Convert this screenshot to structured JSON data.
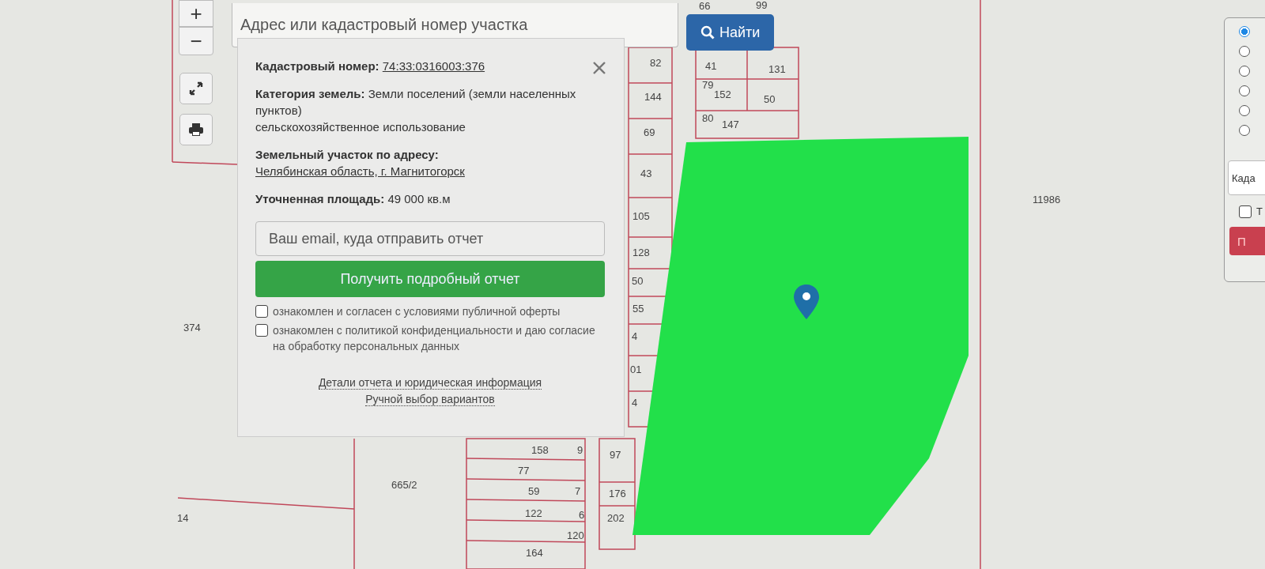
{
  "map_controls": {
    "zoom_in": "+",
    "zoom_out": "−"
  },
  "search": {
    "placeholder": "Адрес или кадастровый номер участка",
    "button": "Найти"
  },
  "popup": {
    "rows": [
      {
        "label": "Кадастровый номер:",
        "value": "74:33:0316003:376",
        "link": true
      },
      {
        "label": "Категория земель:",
        "value": "Земли поселений (земли населенных пунктов)",
        "link": false,
        "extra": "сельскохозяйственное использование"
      },
      {
        "label": "Земельный участок по адресу:",
        "value": "Челябинская область, г. Магнитогорск",
        "link": true
      },
      {
        "label": "Уточненная площадь:",
        "value": "49 000 кв.м",
        "link": false
      }
    ],
    "email_placeholder": "Ваш email, куда отправить отчет",
    "submit": "Получить подробный отчет",
    "agreements": [
      {
        "text": "ознакомлен и согласен с условиями публичной оферты",
        "checked": false
      },
      {
        "text": "ознакомлен с политикой конфиденциальности и даю согласие на обработку персональных данных",
        "checked": false
      }
    ],
    "links": [
      "Детали отчета и юридическая информация",
      "Ручной выбор вариантов"
    ]
  },
  "map": {
    "labels": [
      "66",
      "99",
      "82",
      "41",
      "131",
      "144",
      "79",
      "152",
      "50",
      "69",
      "80",
      "147",
      "43",
      "105",
      "128",
      "50",
      "55",
      "4",
      "01",
      "4",
      "158",
      "9",
      "97",
      "77",
      "59",
      "7",
      "176",
      "122",
      "6",
      "202",
      "120",
      "164",
      "665/2",
      "374",
      "14",
      "11986"
    ]
  },
  "right_panel": {
    "radios": [
      {
        "selected": true
      },
      {
        "selected": false
      },
      {
        "selected": false
      },
      {
        "selected": false
      },
      {
        "selected": false
      },
      {
        "selected": false
      }
    ],
    "field_placeholder": "Када",
    "checkbox": {
      "label": "Т",
      "checked": false
    },
    "button": "П"
  }
}
